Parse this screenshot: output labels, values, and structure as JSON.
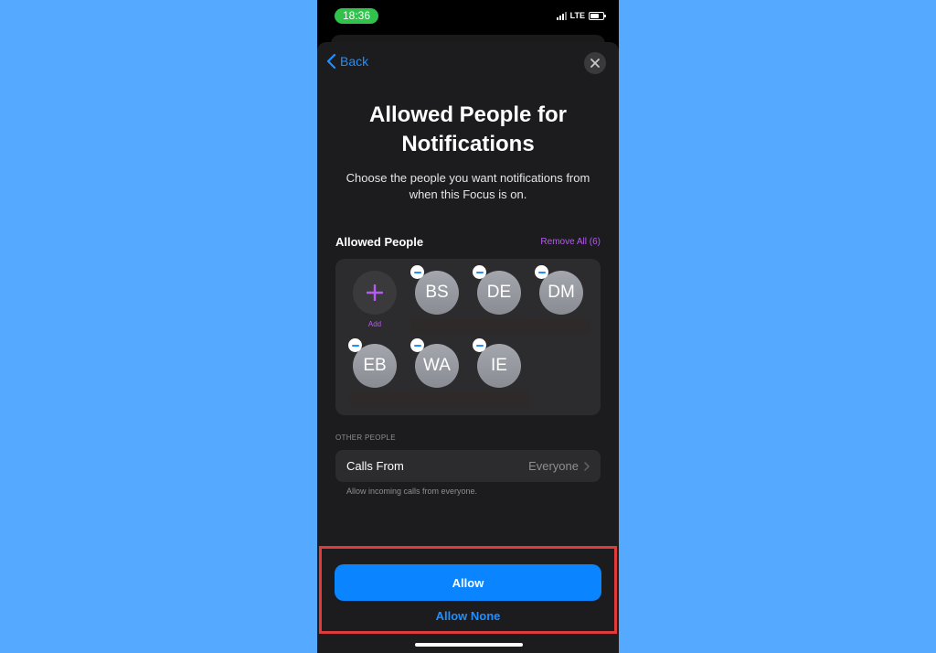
{
  "status_bar": {
    "time": "18:36",
    "network": "LTE",
    "battery_level": 0.7
  },
  "nav": {
    "back_label": "Back",
    "close_icon": "close-icon"
  },
  "header": {
    "title": "Allowed People for Notifications",
    "subtitle": "Choose the people you want notifications from when this Focus is on."
  },
  "allowed_people": {
    "section_title": "Allowed People",
    "remove_all_label": "Remove All (6)",
    "add_label": "Add",
    "people": [
      {
        "initials": "BS"
      },
      {
        "initials": "DE"
      },
      {
        "initials": "DM"
      },
      {
        "initials": "EB"
      },
      {
        "initials": "WA"
      },
      {
        "initials": "IE"
      }
    ]
  },
  "other_people": {
    "section_label": "OTHER PEOPLE",
    "calls_from_label": "Calls From",
    "calls_from_value": "Everyone",
    "calls_note": "Allow incoming calls from everyone."
  },
  "actions": {
    "allow_label": "Allow",
    "allow_none_label": "Allow None"
  },
  "colors": {
    "accent_blue": "#0a84ff",
    "accent_purple": "#b65bf0",
    "highlight_red": "#e03b3b",
    "background": "#55aaff"
  }
}
